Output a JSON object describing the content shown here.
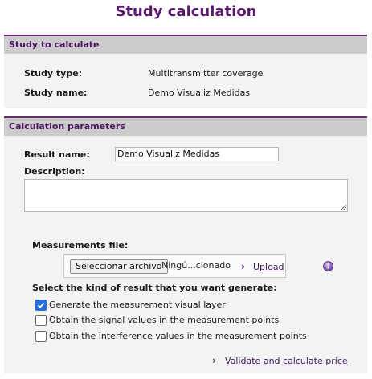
{
  "page": {
    "title": "Study calculation"
  },
  "study_panel": {
    "header": "Study to calculate",
    "study_type_label": "Study type:",
    "study_type_value": "Multitransmitter coverage",
    "study_name_label": "Study name:",
    "study_name_value": "Demo Visualiz Medidas"
  },
  "params_panel": {
    "header": "Calculation parameters",
    "result_name_label": "Result name:",
    "result_name_value": "Demo Visualiz Medidas",
    "description_label": "Description:",
    "description_value": "",
    "measurements_label": "Measurements file:",
    "file_button_label": "Seleccionar archivo",
    "file_name_text": "Ningú...cionado",
    "upload_label": "Upload",
    "help_icon": "help-icon",
    "kind_label": "Select the kind of result that you want generate:",
    "options": [
      {
        "label": "Generate the measurement visual layer",
        "checked": true
      },
      {
        "label": "Obtain the signal values in the measurement points",
        "checked": false
      },
      {
        "label": "Obtain the interference values in the measurement points",
        "checked": false
      }
    ],
    "validate_label": "Validate and calculate price"
  },
  "colors": {
    "title": "#5b1a6e",
    "header_text": "#4a1460",
    "header_border": "#6b2c7c",
    "header_bg": "#cccccc",
    "panel_bg": "#f3f3f3",
    "checkbox_checked": "#1f6fd6"
  }
}
